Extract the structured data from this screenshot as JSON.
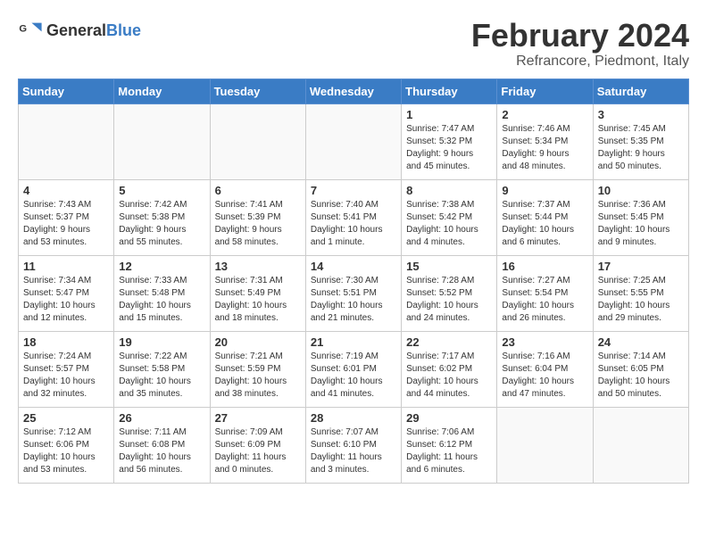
{
  "header": {
    "logo_general": "General",
    "logo_blue": "Blue",
    "title": "February 2024",
    "subtitle": "Refrancore, Piedmont, Italy"
  },
  "weekdays": [
    "Sunday",
    "Monday",
    "Tuesday",
    "Wednesday",
    "Thursday",
    "Friday",
    "Saturday"
  ],
  "weeks": [
    [
      {
        "day": "",
        "info": ""
      },
      {
        "day": "",
        "info": ""
      },
      {
        "day": "",
        "info": ""
      },
      {
        "day": "",
        "info": ""
      },
      {
        "day": "1",
        "info": "Sunrise: 7:47 AM\nSunset: 5:32 PM\nDaylight: 9 hours\nand 45 minutes."
      },
      {
        "day": "2",
        "info": "Sunrise: 7:46 AM\nSunset: 5:34 PM\nDaylight: 9 hours\nand 48 minutes."
      },
      {
        "day": "3",
        "info": "Sunrise: 7:45 AM\nSunset: 5:35 PM\nDaylight: 9 hours\nand 50 minutes."
      }
    ],
    [
      {
        "day": "4",
        "info": "Sunrise: 7:43 AM\nSunset: 5:37 PM\nDaylight: 9 hours\nand 53 minutes."
      },
      {
        "day": "5",
        "info": "Sunrise: 7:42 AM\nSunset: 5:38 PM\nDaylight: 9 hours\nand 55 minutes."
      },
      {
        "day": "6",
        "info": "Sunrise: 7:41 AM\nSunset: 5:39 PM\nDaylight: 9 hours\nand 58 minutes."
      },
      {
        "day": "7",
        "info": "Sunrise: 7:40 AM\nSunset: 5:41 PM\nDaylight: 10 hours\nand 1 minute."
      },
      {
        "day": "8",
        "info": "Sunrise: 7:38 AM\nSunset: 5:42 PM\nDaylight: 10 hours\nand 4 minutes."
      },
      {
        "day": "9",
        "info": "Sunrise: 7:37 AM\nSunset: 5:44 PM\nDaylight: 10 hours\nand 6 minutes."
      },
      {
        "day": "10",
        "info": "Sunrise: 7:36 AM\nSunset: 5:45 PM\nDaylight: 10 hours\nand 9 minutes."
      }
    ],
    [
      {
        "day": "11",
        "info": "Sunrise: 7:34 AM\nSunset: 5:47 PM\nDaylight: 10 hours\nand 12 minutes."
      },
      {
        "day": "12",
        "info": "Sunrise: 7:33 AM\nSunset: 5:48 PM\nDaylight: 10 hours\nand 15 minutes."
      },
      {
        "day": "13",
        "info": "Sunrise: 7:31 AM\nSunset: 5:49 PM\nDaylight: 10 hours\nand 18 minutes."
      },
      {
        "day": "14",
        "info": "Sunrise: 7:30 AM\nSunset: 5:51 PM\nDaylight: 10 hours\nand 21 minutes."
      },
      {
        "day": "15",
        "info": "Sunrise: 7:28 AM\nSunset: 5:52 PM\nDaylight: 10 hours\nand 24 minutes."
      },
      {
        "day": "16",
        "info": "Sunrise: 7:27 AM\nSunset: 5:54 PM\nDaylight: 10 hours\nand 26 minutes."
      },
      {
        "day": "17",
        "info": "Sunrise: 7:25 AM\nSunset: 5:55 PM\nDaylight: 10 hours\nand 29 minutes."
      }
    ],
    [
      {
        "day": "18",
        "info": "Sunrise: 7:24 AM\nSunset: 5:57 PM\nDaylight: 10 hours\nand 32 minutes."
      },
      {
        "day": "19",
        "info": "Sunrise: 7:22 AM\nSunset: 5:58 PM\nDaylight: 10 hours\nand 35 minutes."
      },
      {
        "day": "20",
        "info": "Sunrise: 7:21 AM\nSunset: 5:59 PM\nDaylight: 10 hours\nand 38 minutes."
      },
      {
        "day": "21",
        "info": "Sunrise: 7:19 AM\nSunset: 6:01 PM\nDaylight: 10 hours\nand 41 minutes."
      },
      {
        "day": "22",
        "info": "Sunrise: 7:17 AM\nSunset: 6:02 PM\nDaylight: 10 hours\nand 44 minutes."
      },
      {
        "day": "23",
        "info": "Sunrise: 7:16 AM\nSunset: 6:04 PM\nDaylight: 10 hours\nand 47 minutes."
      },
      {
        "day": "24",
        "info": "Sunrise: 7:14 AM\nSunset: 6:05 PM\nDaylight: 10 hours\nand 50 minutes."
      }
    ],
    [
      {
        "day": "25",
        "info": "Sunrise: 7:12 AM\nSunset: 6:06 PM\nDaylight: 10 hours\nand 53 minutes."
      },
      {
        "day": "26",
        "info": "Sunrise: 7:11 AM\nSunset: 6:08 PM\nDaylight: 10 hours\nand 56 minutes."
      },
      {
        "day": "27",
        "info": "Sunrise: 7:09 AM\nSunset: 6:09 PM\nDaylight: 11 hours\nand 0 minutes."
      },
      {
        "day": "28",
        "info": "Sunrise: 7:07 AM\nSunset: 6:10 PM\nDaylight: 11 hours\nand 3 minutes."
      },
      {
        "day": "29",
        "info": "Sunrise: 7:06 AM\nSunset: 6:12 PM\nDaylight: 11 hours\nand 6 minutes."
      },
      {
        "day": "",
        "info": ""
      },
      {
        "day": "",
        "info": ""
      }
    ]
  ]
}
